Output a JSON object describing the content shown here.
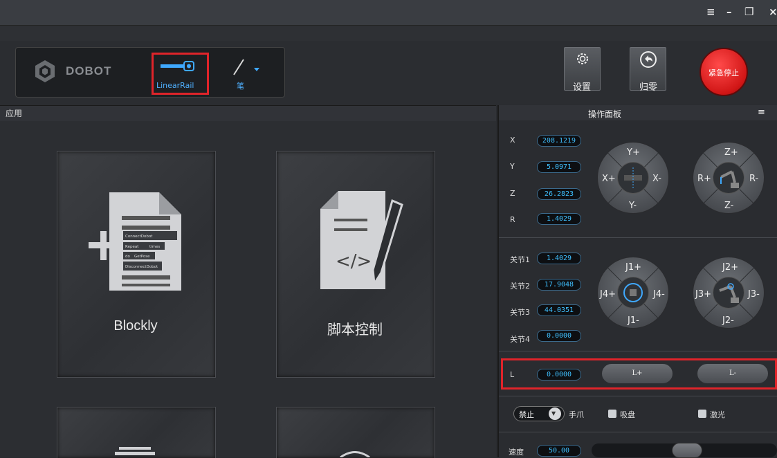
{
  "window": {
    "controls": [
      "≡",
      "–",
      "❐",
      "×"
    ]
  },
  "toolbar": {
    "brand": "DOBOT",
    "linear_rail_label": "LinearRail",
    "pen_label": "笔",
    "settings_label": "设置",
    "home_label": "归零",
    "estop_label": "紧急停止"
  },
  "left_panel": {
    "title": "应用",
    "tiles": [
      {
        "label": "Blockly"
      },
      {
        "label": "脚本控制"
      },
      {
        "label": ""
      },
      {
        "label": ""
      }
    ],
    "blockly_snippet": [
      "ConnectDobot",
      "Repeat",
      "times",
      "do",
      "GetPose",
      "DisconnectDobot"
    ]
  },
  "right_panel": {
    "title": "操作面板",
    "cartesian": [
      {
        "label": "X",
        "value": "208.1219"
      },
      {
        "label": "Y",
        "value": "5.0971"
      },
      {
        "label": "Z",
        "value": "26.2823"
      },
      {
        "label": "R",
        "value": "1.4029"
      }
    ],
    "joints": [
      {
        "label": "关节1",
        "value": "1.4029"
      },
      {
        "label": "关节2",
        "value": "17.9048"
      },
      {
        "label": "关节3",
        "value": "44.0351"
      },
      {
        "label": "关节4",
        "value": "0.0000"
      }
    ],
    "dial_xy": {
      "top": "Y+",
      "bottom": "Y-",
      "left": "X+",
      "right": "X-"
    },
    "dial_zr": {
      "top": "Z+",
      "bottom": "Z-",
      "left": "R+",
      "right": "R-"
    },
    "dial_j14": {
      "top": "J1+",
      "bottom": "J1-",
      "left": "J4+",
      "right": "J4-"
    },
    "dial_j23": {
      "top": "J2+",
      "bottom": "J2-",
      "left": "J3+",
      "right": "J3-"
    },
    "rail": {
      "label": "L",
      "value": "0.0000",
      "plus": "L+",
      "minus": "L-"
    },
    "gripper": {
      "toggle_label": "禁止",
      "gripper_label": "手爪",
      "suction_label": "吸盘",
      "laser_label": "激光"
    },
    "speed": {
      "label": "速度",
      "value": "50.00"
    }
  }
}
